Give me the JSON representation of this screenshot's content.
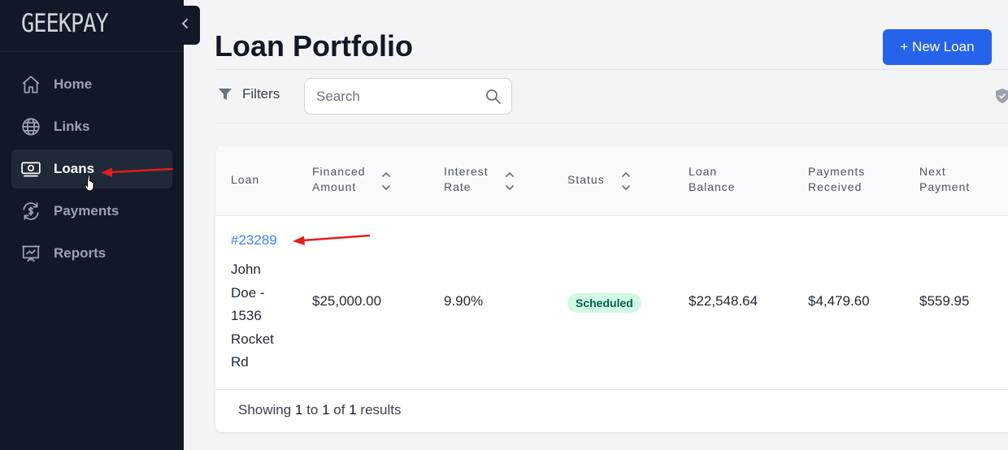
{
  "sidebar": {
    "logo": "GEEKPAY",
    "items": [
      {
        "label": "Home",
        "icon": "home-icon"
      },
      {
        "label": "Links",
        "icon": "globe-icon"
      },
      {
        "label": "Loans",
        "icon": "cash-icon",
        "active": true
      },
      {
        "label": "Payments",
        "icon": "payments-icon"
      },
      {
        "label": "Reports",
        "icon": "reports-icon"
      }
    ]
  },
  "header": {
    "title": "Loan Portfolio",
    "new_button": "+ New Loan"
  },
  "toolbar": {
    "filters_label": "Filters",
    "search_placeholder": "Search"
  },
  "table": {
    "columns": [
      {
        "l1": "Loan",
        "l2": ""
      },
      {
        "l1": "Financed",
        "l2": "Amount",
        "sortable": true
      },
      {
        "l1": "Interest",
        "l2": "Rate",
        "sortable": true
      },
      {
        "l1": "Status",
        "l2": "",
        "sortable": true
      },
      {
        "l1": "Loan",
        "l2": "Balance"
      },
      {
        "l1": "Payments",
        "l2": "Received"
      },
      {
        "l1": "Next",
        "l2": "Payment"
      }
    ],
    "rows": [
      {
        "loan_id": "#23289",
        "loan_desc": "John Doe - 1536 Rocket Rd",
        "financed_amount": "$25,000.00",
        "interest_rate": "9.90%",
        "status": "Scheduled",
        "loan_balance": "$22,548.64",
        "payments_received": "$4,479.60",
        "next_payment": "$559.95"
      }
    ],
    "footer": {
      "showing": "Showing",
      "from": "1",
      "to_word": "to",
      "to": "1",
      "of_word": "of",
      "total": "1",
      "results": "results"
    }
  },
  "colors": {
    "sidebar_bg": "#111827",
    "accent": "#2563eb",
    "link": "#3b82f6",
    "badge_bg": "#d1fae5",
    "annotation": "#e11d1d"
  }
}
